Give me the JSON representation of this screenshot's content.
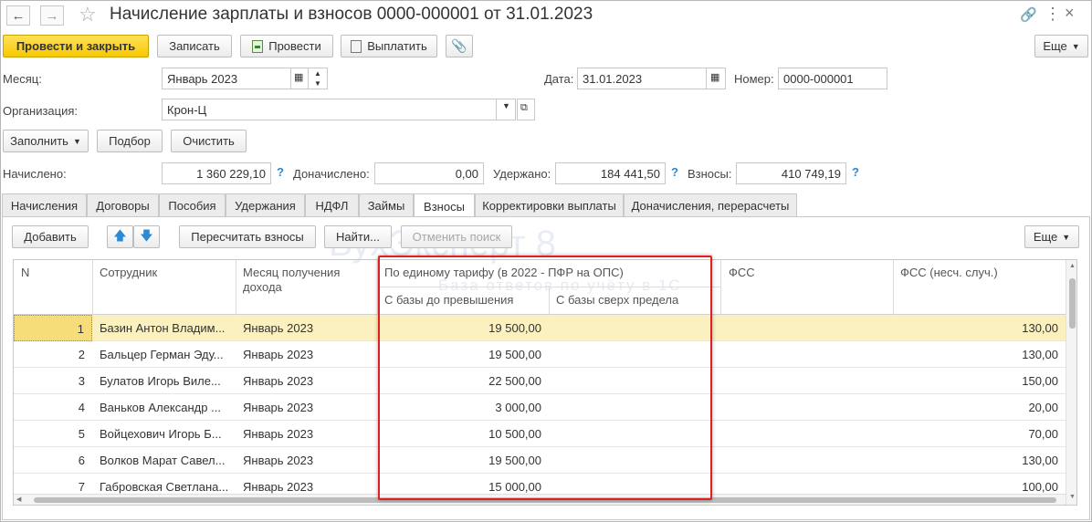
{
  "window": {
    "title": "Начисление зарплаты и взносов 0000-000001 от 31.01.2023"
  },
  "toolbar": {
    "post_close": "Провести и закрыть",
    "save": "Записать",
    "post": "Провести",
    "pay": "Выплатить",
    "more": "Еще"
  },
  "form": {
    "month_label": "Месяц:",
    "month_value": "Январь 2023",
    "date_label": "Дата:",
    "date_value": "31.01.2023",
    "number_label": "Номер:",
    "number_value": "0000-000001",
    "org_label": "Организация:",
    "org_value": "Крон-Ц",
    "fill": "Заполнить",
    "select": "Подбор",
    "clear": "Очистить",
    "accrued_label": "Начислено:",
    "accrued_value": "1 360 229,10",
    "extra_label": "Доначислено:",
    "extra_value": "0,00",
    "withheld_label": "Удержано:",
    "withheld_value": "184 441,50",
    "contrib_label": "Взносы:",
    "contrib_value": "410 749,19",
    "help": "?"
  },
  "tabs": [
    "Начисления",
    "Договоры",
    "Пособия",
    "Удержания",
    "НДФЛ",
    "Займы",
    "Взносы",
    "Корректировки выплаты",
    "Доначисления, перерасчеты"
  ],
  "active_tab": "Взносы",
  "grid_toolbar": {
    "add": "Добавить",
    "recalc": "Пересчитать взносы",
    "find": "Найти...",
    "cancel_find": "Отменить поиск",
    "more": "Еще"
  },
  "grid": {
    "headers": {
      "n": "N",
      "employee": "Сотрудник",
      "month": "Месяц получения дохода",
      "tariff": "По единому тарифу (в 2022 - ПФР на ОПС)",
      "base_below": "С базы до превышения",
      "base_above": "С базы сверх предела",
      "fss": "ФСС",
      "fss_ns": "ФСС (несч. случ.)"
    },
    "rows": [
      {
        "n": "1",
        "employee": "Базин Антон Владим...",
        "month": "Январь 2023",
        "below": "19 500,00",
        "above": "",
        "fss": "",
        "fss_ns": "130,00"
      },
      {
        "n": "2",
        "employee": "Бальцер Герман Эду...",
        "month": "Январь 2023",
        "below": "19 500,00",
        "above": "",
        "fss": "",
        "fss_ns": "130,00"
      },
      {
        "n": "3",
        "employee": "Булатов Игорь Виле...",
        "month": "Январь 2023",
        "below": "22 500,00",
        "above": "",
        "fss": "",
        "fss_ns": "150,00"
      },
      {
        "n": "4",
        "employee": "Ваньков Александр ...",
        "month": "Январь 2023",
        "below": "3 000,00",
        "above": "",
        "fss": "",
        "fss_ns": "20,00"
      },
      {
        "n": "5",
        "employee": "Войцехович Игорь Б...",
        "month": "Январь 2023",
        "below": "10 500,00",
        "above": "",
        "fss": "",
        "fss_ns": "70,00"
      },
      {
        "n": "6",
        "employee": "Волков Марат Савел...",
        "month": "Январь 2023",
        "below": "19 500,00",
        "above": "",
        "fss": "",
        "fss_ns": "130,00"
      },
      {
        "n": "7",
        "employee": "Габровская Светлана...",
        "month": "Январь 2023",
        "below": "15 000,00",
        "above": "",
        "fss": "",
        "fss_ns": "100,00"
      }
    ]
  },
  "watermark": {
    "line1": "БухЭксперт 8",
    "line2": "База ответов по учёту в 1С"
  },
  "colors": {
    "primary": "#f7c900",
    "selected_row": "#fbf0c0",
    "highlight": "#e02020",
    "help": "#2a8ad6"
  }
}
